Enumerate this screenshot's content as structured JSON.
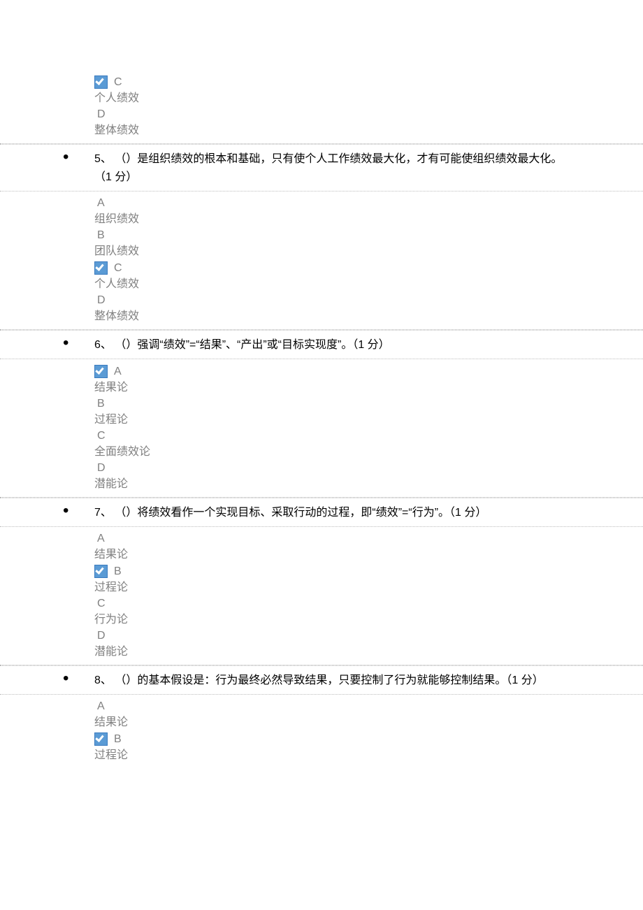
{
  "partial_top": {
    "options": [
      {
        "letter": "C",
        "text": "个人绩效",
        "checked": true
      },
      {
        "letter": "D",
        "text": "整体绩效",
        "checked": false
      }
    ]
  },
  "questions": [
    {
      "number": "5、",
      "text": "（）是组织绩效的根本和基础，只有使个人工作绩效最大化，才有可能使组织绩效最大化。（1 分）",
      "options": [
        {
          "letter": "A",
          "text": "组织绩效",
          "checked": false
        },
        {
          "letter": "B",
          "text": "团队绩效",
          "checked": false
        },
        {
          "letter": "C",
          "text": "个人绩效",
          "checked": true
        },
        {
          "letter": "D",
          "text": "整体绩效",
          "checked": false
        }
      ]
    },
    {
      "number": "6、",
      "text": "（）强调“绩效”=“结果”、“产出”或“目标实现度”。（1 分）",
      "options": [
        {
          "letter": "A",
          "text": "结果论",
          "checked": true
        },
        {
          "letter": "B",
          "text": "过程论",
          "checked": false
        },
        {
          "letter": "C",
          "text": "全面绩效论",
          "checked": false
        },
        {
          "letter": "D",
          "text": "潜能论",
          "checked": false
        }
      ]
    },
    {
      "number": "7、",
      "text": "（）将绩效看作一个实现目标、采取行动的过程，即“绩效”=“行为”。（1 分）",
      "options": [
        {
          "letter": "A",
          "text": "结果论",
          "checked": false
        },
        {
          "letter": "B",
          "text": "过程论",
          "checked": true
        },
        {
          "letter": "C",
          "text": "行为论",
          "checked": false
        },
        {
          "letter": "D",
          "text": "潜能论",
          "checked": false
        }
      ]
    },
    {
      "number": "8、",
      "text": "（）的基本假设是：行为最终必然导致结果，只要控制了行为就能够控制结果。（1 分）",
      "options": [
        {
          "letter": "A",
          "text": "结果论",
          "checked": false
        },
        {
          "letter": "B",
          "text": "过程论",
          "checked": true
        }
      ]
    }
  ]
}
